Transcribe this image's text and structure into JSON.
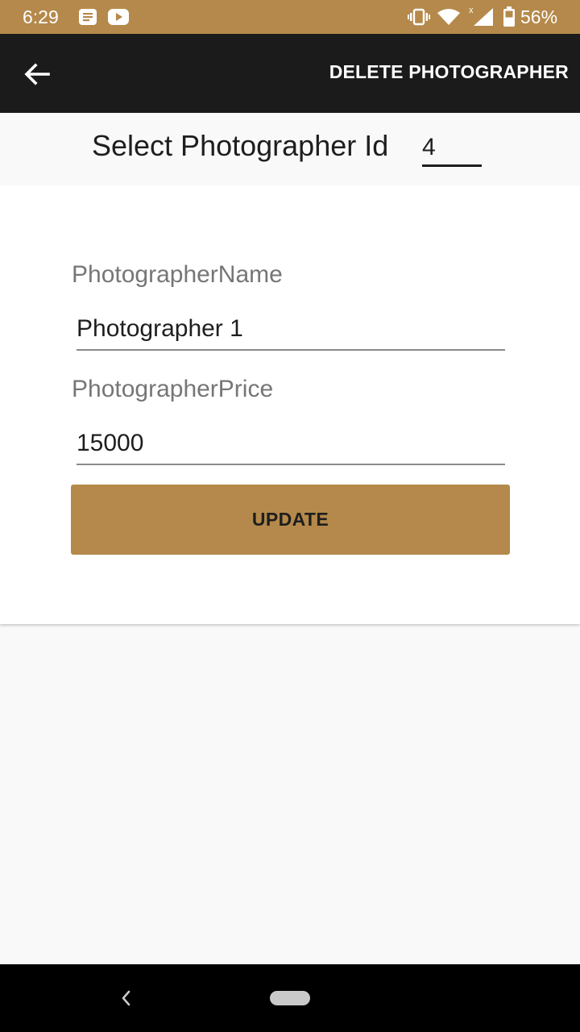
{
  "status_bar": {
    "time": "6:29",
    "battery": "56%",
    "icons": [
      "notes-icon",
      "youtube-icon",
      "vibrate-icon",
      "wifi-icon",
      "signal-icon",
      "battery-icon"
    ]
  },
  "toolbar": {
    "back_icon": "arrow-left-icon",
    "delete_label": "DELETE PHOTOGRAPHER"
  },
  "select_id": {
    "label": "Select Photographer Id",
    "value": "4"
  },
  "form": {
    "name_label": "PhotographerName",
    "name_value": "Photographer 1",
    "price_label": "PhotographerPrice",
    "price_value": "15000",
    "update_label": "UPDATE"
  },
  "nav_bar": {
    "icons": [
      "nav-back-icon",
      "home-pill-icon"
    ]
  },
  "colors": {
    "accent": "#b5894b",
    "toolbar": "#1b1b1b",
    "background": "#f9f9f9"
  }
}
